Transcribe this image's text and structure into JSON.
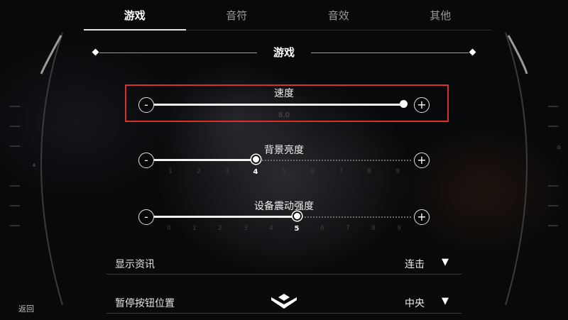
{
  "tabs": [
    {
      "label": "游戏",
      "active": true
    },
    {
      "label": "音符",
      "active": false
    },
    {
      "label": "音效",
      "active": false
    },
    {
      "label": "其他",
      "active": false
    }
  ],
  "section": {
    "title": "游戏"
  },
  "sliders": {
    "speed": {
      "label": "速度",
      "value_text": "8.0",
      "value_fraction": 0.97,
      "minus": "-",
      "plus": "+"
    },
    "brightness": {
      "label": "背景亮度",
      "value": 4,
      "ticks": [
        "1",
        "2",
        "3",
        "4",
        "5",
        "6",
        "7",
        "8",
        "9"
      ],
      "minus": "-",
      "plus": "+"
    },
    "vibration": {
      "label": "设备震动强度",
      "value": 5,
      "ticks": [
        "0",
        "1",
        "2",
        "3",
        "4",
        "5",
        "6",
        "7",
        "8",
        "9"
      ],
      "minus": "-",
      "plus": "+"
    }
  },
  "options": [
    {
      "label": "显示资讯",
      "value": "连击",
      "arrow": "▼"
    },
    {
      "label": "暂停按钮位置",
      "value": "中央",
      "arrow": "▼"
    }
  ],
  "back_label": "返回",
  "side_markers": {
    "left": "A",
    "right": "D"
  },
  "colors": {
    "highlight": "#d9302b",
    "accent": "#ffffff"
  }
}
